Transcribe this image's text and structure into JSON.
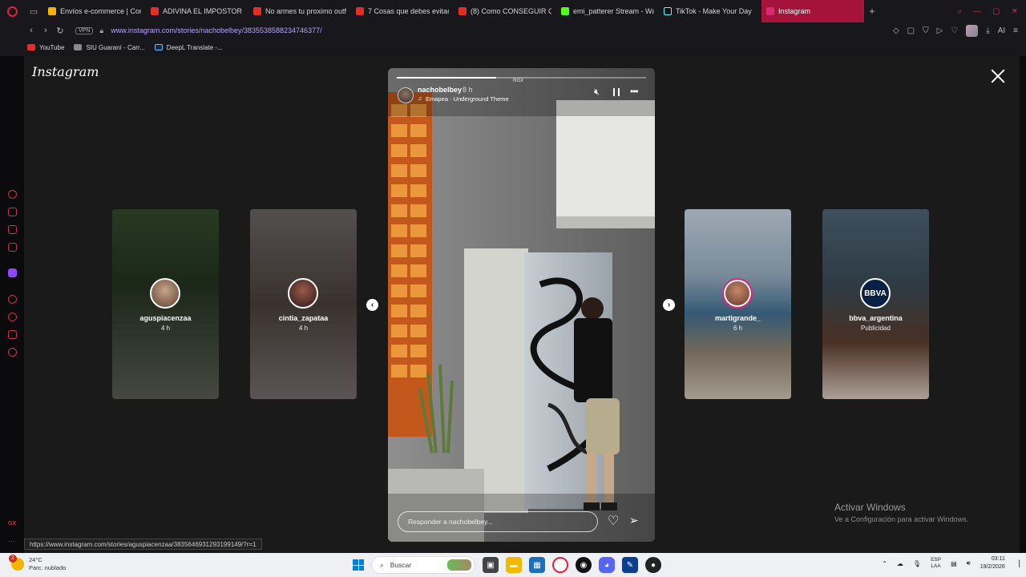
{
  "browser": {
    "tabs": [
      {
        "label": "Envíos e-commerce | Cor",
        "color": "#f4b400"
      },
      {
        "label": "ADIVINA EL IMPOSTOR FU",
        "color": "#e52d27"
      },
      {
        "label": "No armes tu proximo outf",
        "color": "#e52d27"
      },
      {
        "label": "7 Cosas que debes evitar",
        "color": "#e52d27"
      },
      {
        "label": "(8) Como CONSEGUIR CL",
        "color": "#e52d27"
      },
      {
        "label": "emi_patterer Stream - Wa",
        "color": "#53fc18"
      },
      {
        "label": "TikTok - Make Your Day",
        "color": "#111111"
      },
      {
        "label": "Instagram",
        "color": "#d62976",
        "active": true
      }
    ],
    "url": "www.instagram.com/stories/nachobelbey/3835538588234746377/",
    "vpn_label": "VPN",
    "ai_label": "AI",
    "bookmarks": [
      {
        "label": "YouTube",
        "color": "#e52d27"
      },
      {
        "label": "SIU Guaraní - Carr...",
        "color": "#888888"
      },
      {
        "label": "DeepL Translate -...",
        "color": "#0f2b46"
      }
    ]
  },
  "instagram": {
    "logo": "Instagram",
    "main_story": {
      "username": "nachobelbey",
      "time": "8 h",
      "music": "Emapea · Underground Theme",
      "top_label": "RGX",
      "progress": 0.4,
      "reply_placeholder": "Responder a nachobelbey..."
    },
    "previews": [
      {
        "username": "aguspiacenzaa",
        "time": "4 h"
      },
      {
        "username": "cintia_zapataa",
        "time": "4 h"
      },
      {
        "username": "martigrande_",
        "time": "6 h"
      },
      {
        "username": "bbva_argentina",
        "time": "Publicidad",
        "logo": "BBVA"
      }
    ]
  },
  "watermark": {
    "title": "Activar Windows",
    "subtitle": "Ve a Configuración para activar Windows."
  },
  "status_url": "https://www.instagram.com/stories/aguspiacenzaa/3835646931293199149/?r=1",
  "taskbar": {
    "weather_temp": "24°C",
    "weather_desc": "Parc. nublado",
    "weather_badge": "2",
    "search_label": "Buscar",
    "lang_top": "ESP",
    "lang_bottom": "LAA",
    "time": "03:11",
    "date": "19/2/2026"
  }
}
